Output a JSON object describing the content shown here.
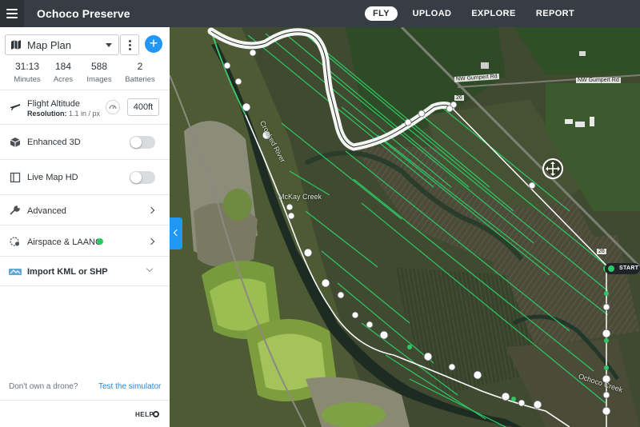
{
  "header": {
    "title": "Ochoco Preserve",
    "nav": {
      "fly": "FLY",
      "upload": "UPLOAD",
      "explore": "EXPLORE",
      "report": "REPORT"
    },
    "active_tab": "FLY"
  },
  "panel": {
    "plan_name": "Map Plan",
    "stats": [
      {
        "value": "31:13",
        "unit": "Minutes"
      },
      {
        "value": "184",
        "unit": "Acres"
      },
      {
        "value": "588",
        "unit": "Images"
      },
      {
        "value": "2",
        "unit": "Batteries"
      }
    ],
    "altitude": {
      "title": "Flight Altitude",
      "resolution_label": "Resolution:",
      "resolution_value": "1.1 in / px",
      "value": "400ft"
    },
    "enhanced_3d": {
      "label": "Enhanced 3D",
      "enabled": false
    },
    "live_map_hd": {
      "label": "Live Map HD",
      "enabled": false
    },
    "advanced": {
      "label": "Advanced"
    },
    "airspace": {
      "label": "Airspace & LAANC",
      "status_color": "#2ec866"
    },
    "import": {
      "label": "Import KML or SHP"
    },
    "no_drone": "Don't own a drone?",
    "simulator_link": "Test the simulator",
    "help": "HELP"
  },
  "map": {
    "labels": {
      "creek": "McKay Creek",
      "river": "Crooked River",
      "ochoco": "Ochoco Creek",
      "road1": "NW Gumpert Rd",
      "road2": "NW Gumpert Rd",
      "route_a": "26",
      "route_b": "26"
    },
    "start_label": "START",
    "flight_line_color": "#2ec866",
    "accent_color": "#2196f3"
  }
}
